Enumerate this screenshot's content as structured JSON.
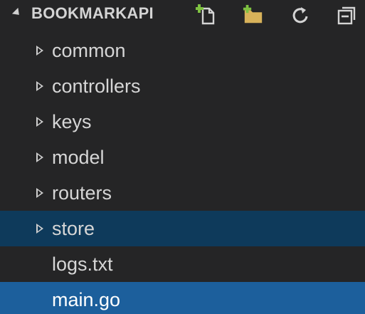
{
  "explorer": {
    "title": "BOOKMARKAPI",
    "actions": [
      {
        "name": "new-file-icon"
      },
      {
        "name": "new-folder-icon"
      },
      {
        "name": "refresh-icon"
      },
      {
        "name": "collapse-all-icon"
      }
    ],
    "items": [
      {
        "label": "common",
        "type": "folder"
      },
      {
        "label": "controllers",
        "type": "folder"
      },
      {
        "label": "keys",
        "type": "folder"
      },
      {
        "label": "model",
        "type": "folder"
      },
      {
        "label": "routers",
        "type": "folder"
      },
      {
        "label": "store",
        "type": "folder"
      },
      {
        "label": "logs.txt",
        "type": "file"
      },
      {
        "label": "main.go",
        "type": "file"
      }
    ]
  },
  "colors": {
    "background": "#252526",
    "selected_row": "#0e3a5b",
    "active_row": "#1c5f9c",
    "new_icon_accent": "#7fc241",
    "folder_color": "#d8b25a"
  }
}
